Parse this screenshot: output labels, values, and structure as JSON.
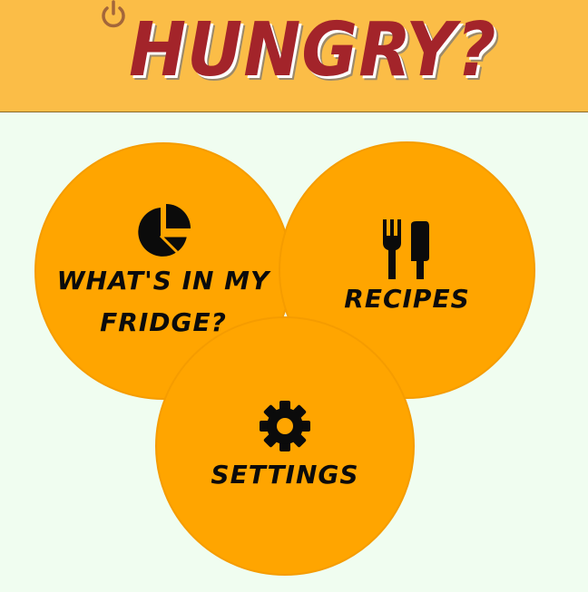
{
  "header": {
    "title": "HUNGRY?",
    "power_icon": "power-icon",
    "background_color": "#fbbd47",
    "title_color": "#a3242a"
  },
  "menu": {
    "tile_color": "#ffa500",
    "items": [
      {
        "label_line1": "WHAT'S IN MY",
        "label_line2": "FRIDGE?",
        "icon": "pie-chart-icon"
      },
      {
        "label": "RECIPES",
        "icon": "fork-knife-icon"
      },
      {
        "label": "SETTINGS",
        "icon": "gear-icon"
      }
    ]
  }
}
